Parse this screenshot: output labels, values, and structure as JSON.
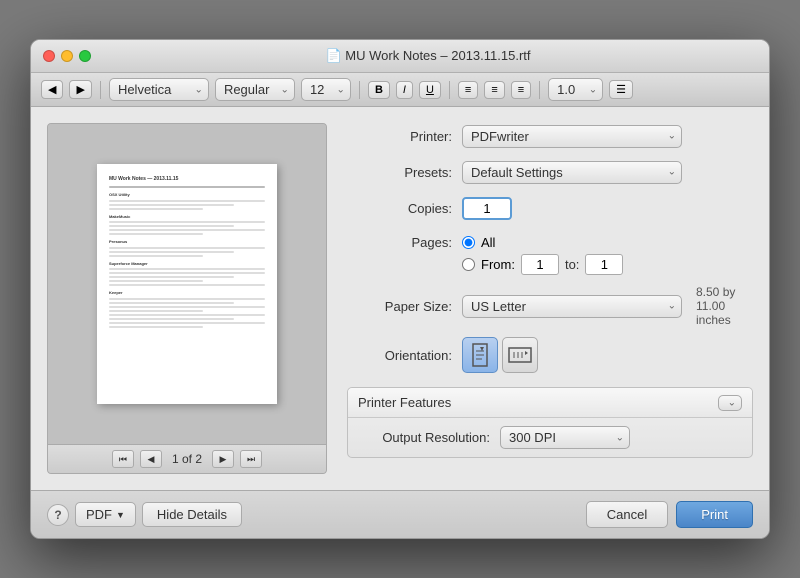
{
  "window": {
    "title": "MU Work Notes – 2013.11.15.rtf",
    "traffic_lights": [
      "close",
      "minimize",
      "maximize"
    ]
  },
  "toolbar": {
    "font_family": "Helvetica",
    "font_style": "Regular",
    "font_size": "12",
    "bold": "B",
    "italic": "I",
    "underline": "U",
    "line_spacing": "1.0"
  },
  "print_options": {
    "printer_label": "Printer:",
    "printer_value": "PDFwriter",
    "presets_label": "Presets:",
    "presets_value": "Default Settings",
    "copies_label": "Copies:",
    "copies_value": "1",
    "pages_label": "Pages:",
    "pages_all": "All",
    "pages_from": "From:",
    "pages_from_value": "1",
    "pages_to": "to:",
    "pages_to_value": "1",
    "paper_size_label": "Paper Size:",
    "paper_size_value": "US Letter",
    "paper_size_info": "8.50 by 11.00 inches",
    "orientation_label": "Orientation:",
    "features_title": "Printer Features",
    "output_resolution_label": "Output Resolution:",
    "output_resolution_value": "300 DPI"
  },
  "preview": {
    "page_indicator": "1 of 2",
    "nav": {
      "first": "⏮",
      "prev": "◀",
      "next": "▶",
      "last": "⏭"
    }
  },
  "bottom_bar": {
    "help": "?",
    "pdf_label": "PDF",
    "pdf_arrow": "▼",
    "hide_details": "Hide Details",
    "cancel": "Cancel",
    "print": "Print"
  },
  "preview_content": {
    "title": "MU Work Notes — 2013.11.15",
    "sections": [
      {
        "heading": "OSX Utility",
        "lines": 3
      },
      {
        "heading": "MakeMusic",
        "lines": 4
      },
      {
        "heading": "Presonus",
        "lines": 3
      },
      {
        "heading": "Superforce Manager",
        "lines": 5
      },
      {
        "heading": "Keeper",
        "lines": 8
      }
    ]
  }
}
